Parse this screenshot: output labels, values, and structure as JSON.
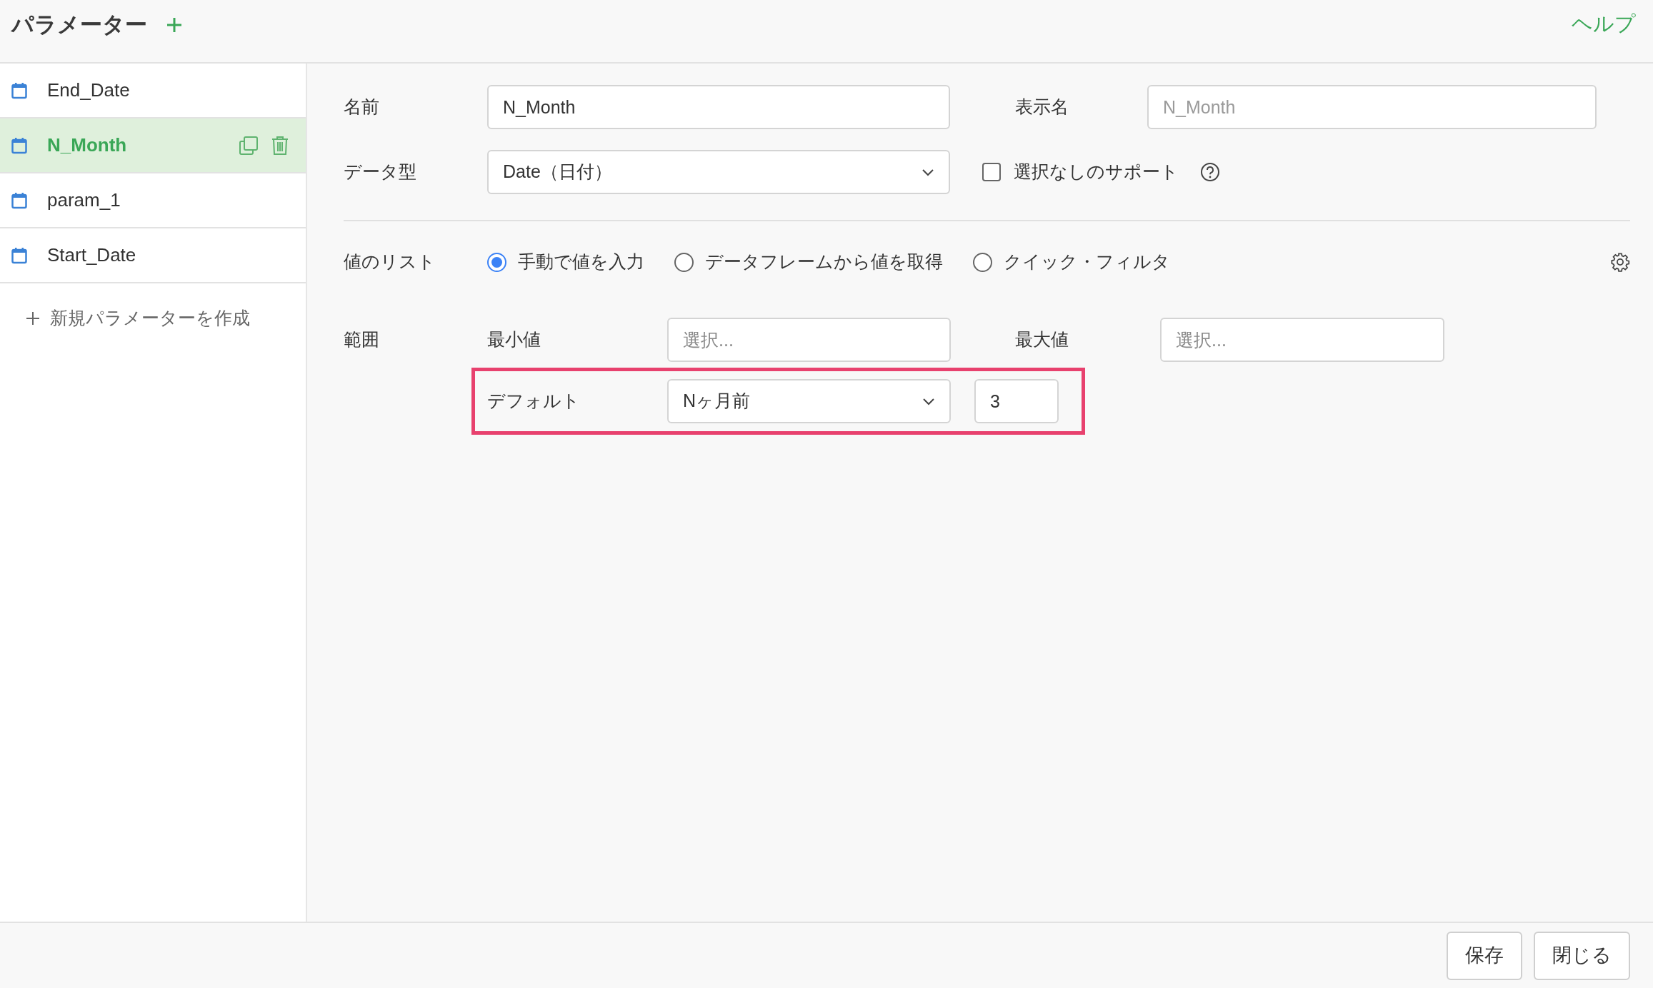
{
  "header": {
    "title": "パラメーター",
    "help_link": "ヘルプ"
  },
  "sidebar": {
    "items": [
      {
        "name": "End_Date",
        "selected": false
      },
      {
        "name": "N_Month",
        "selected": true
      },
      {
        "name": "param_1",
        "selected": false
      },
      {
        "name": "Start_Date",
        "selected": false
      }
    ],
    "create_link": "新規パラメーターを作成"
  },
  "form": {
    "name": {
      "label": "名前",
      "value": "N_Month"
    },
    "display_name": {
      "label": "表示名",
      "placeholder": "N_Month"
    },
    "data_type": {
      "label": "データ型",
      "value": "Date（日付）"
    },
    "support_none": {
      "label": "選択なしのサポート",
      "checked": false
    },
    "value_list": {
      "label": "値のリスト",
      "options": [
        {
          "label": "手動で値を入力",
          "selected": true
        },
        {
          "label": "データフレームから値を取得",
          "selected": false
        },
        {
          "label": "クイック・フィルタ",
          "selected": false
        }
      ]
    },
    "range": {
      "label": "範囲",
      "min_label": "最小値",
      "min_placeholder": "選択...",
      "max_label": "最大値",
      "max_placeholder": "選択..."
    },
    "default": {
      "label": "デフォルト",
      "select_value": "Nヶ月前",
      "number_value": "3",
      "highlighted": true
    }
  },
  "footer": {
    "buttons": [
      "保存",
      "閉じる"
    ]
  }
}
